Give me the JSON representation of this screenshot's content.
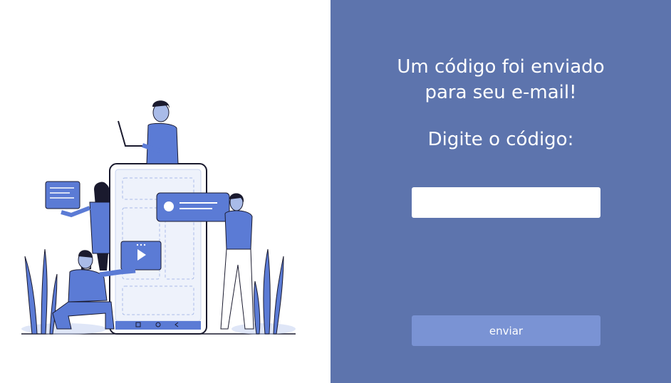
{
  "dialog": {
    "title_line1": "Um código foi enviado",
    "title_line2": "para seu e-mail!",
    "prompt": "Digite o código:",
    "code_input_value": "",
    "code_input_placeholder": "",
    "submit_label": "enviar"
  },
  "colors": {
    "panel_background": "#5d74ad",
    "button_background": "#7a93d4",
    "illustration_accent": "#5b7bd5"
  }
}
